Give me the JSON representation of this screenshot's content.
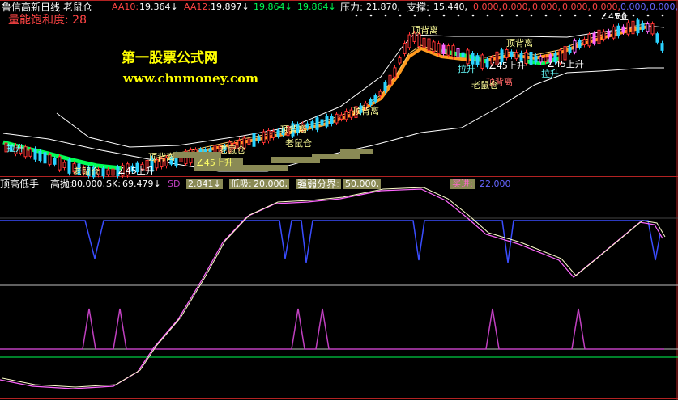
{
  "colors": {
    "bg": "#000000",
    "frame": "#b22222",
    "white": "#ffffff",
    "red": "#ff3333",
    "green": "#00ff55",
    "orange": "#ff9a1f",
    "yellow": "#ffff00",
    "blue": "#3a4dff",
    "magenta": "#c040c0",
    "pink": "#ff66cc",
    "cyan": "#66ffff",
    "gray": "#c0c0c0"
  },
  "top": {
    "title": "鲁信高新日线 老鼠仓",
    "aa10_label": "AA10:",
    "aa10_value": "19.364↓",
    "aa12_label": "AA12:",
    "aa12_value": "19.897↓",
    "v3": "19.864↓",
    "v4": "19.864↓",
    "pressure_label": "压力:",
    "pressure_value": "21.870,",
    "support_label": "支撑:",
    "support_value": "15.440,",
    "zeros": [
      "0.000,",
      "0.000,",
      "0.000,",
      "0.000,",
      "0.000,",
      "0.000,",
      "0.000,"
    ],
    "saturation": "量能饱和度: 28"
  },
  "watermark": {
    "site_name": "第一股票公式网",
    "url": "www.chnmoney.com"
  },
  "main_annotations": {
    "pullback_1": "拉升",
    "pullback_2": "拉升",
    "pullback_3": "拉升",
    "top_div_1": "顶背离",
    "top_div_2": "顶背离",
    "top_div_3": "顶背离",
    "top_div_4": "顶背离",
    "top_div_5": "顶背离",
    "top_div_6": "顶背离",
    "rat_1": "老鼠仓",
    "rat_2": "老鼠仓",
    "rat_3": "老鼠仓",
    "rat_4": "老鼠仓",
    "rise_45_1": "∠45上升",
    "rise_45_2": "∠45上升",
    "rise_45_3": "∠45上升",
    "rise_45_4": "∠45上升",
    "corner_label": "∠45上",
    "axis_price_zero": "00"
  },
  "sub_header": {
    "indicator_name": "顶高低手",
    "high_throw_label": "高抛:",
    "high_throw_value": "80.000,",
    "sk_label": "SK:",
    "sk_value": "69.479↓",
    "sd_label": "SD",
    "sd_value": "2.841↓",
    "low_buy_label": "低吸:",
    "low_buy_value": "20.000,",
    "strong_weak_label": "强弱分界:",
    "strong_weak_value": "50.000,",
    "buy_in_label": "买进:",
    "buy_in_value": "22.000"
  }
}
